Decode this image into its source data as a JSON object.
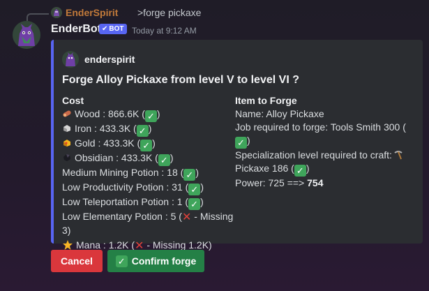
{
  "reply": {
    "username": "EnderSpirit",
    "command": ">forge pickaxe"
  },
  "message": {
    "author": "EnderBot",
    "badge": "BOT",
    "timestamp": "Today at 9:12 AM"
  },
  "embed": {
    "accent": "#5865f2",
    "author": "enderspirit",
    "title": "Forge Alloy Pickaxe from level V to level VI ?",
    "cost": {
      "heading": "Cost",
      "wood": "Wood : 866.6K (",
      "iron": "Iron : 433.3K (",
      "gold": "Gold : 433.3K (",
      "obsidian": "Obsidian : 433.3K (",
      "mining": "Medium Mining Potion : 18 (",
      "productivity": "Low Productivity Potion : 31 (",
      "teleport": "Low Teleportation Potion : 1 (",
      "elementary_1": "Low Elementary Potion : 5 (",
      "elementary_missing": " - Missing",
      "elementary_2": "3)",
      "mana": "Mana : 1.2K (",
      "mana_missing": " - Missing 1.2K)",
      "close": ")"
    },
    "item": {
      "heading": "Item to Forge",
      "name": "Name: Alloy Pickaxe",
      "job_1": "Job required to forge: Tools Smith 300 (",
      "close": ")",
      "spec_1": "Specialization level required to craft:",
      "spec_2": "Pickaxe 186 (",
      "power_prefix": "Power: 725 ==> ",
      "power_value": "754"
    }
  },
  "buttons": {
    "cancel": "Cancel",
    "confirm": "Confirm forge"
  },
  "colors": {
    "cancel": "#da373c",
    "confirm": "#248046",
    "check": "#3fa55b",
    "cross": "#e0403a"
  }
}
